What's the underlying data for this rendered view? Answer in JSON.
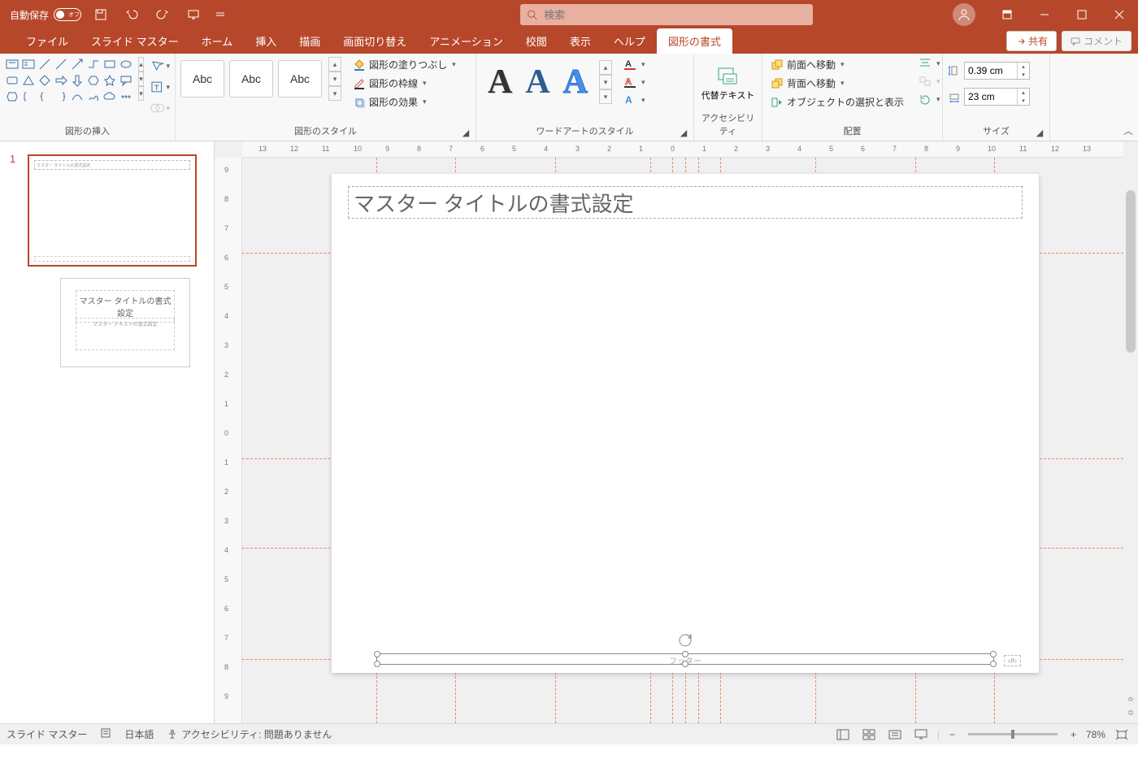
{
  "titlebar": {
    "autosave_label": "自動保存",
    "autosave_state": "オフ",
    "search_placeholder": "検索"
  },
  "tabs": {
    "file": "ファイル",
    "slide_master": "スライド マスター",
    "home": "ホーム",
    "insert": "挿入",
    "draw": "描画",
    "transitions": "画面切り替え",
    "animations": "アニメーション",
    "review": "校閲",
    "view": "表示",
    "help": "ヘルプ",
    "shape_format": "図形の書式",
    "share": "共有",
    "comment": "コメント"
  },
  "ribbon": {
    "groups": {
      "insert_shapes": "図形の挿入",
      "shape_styles": "図形のスタイル",
      "wordart_styles": "ワードアートのスタイル",
      "accessibility": "アクセシビリティ",
      "arrange": "配置",
      "size": "サイズ"
    },
    "style_swatch_text": "Abc",
    "shape_fill": "図形の塗りつぶし",
    "shape_outline": "図形の枠線",
    "shape_effects": "図形の効果",
    "alt_text": "代替テキスト",
    "bring_forward": "前面へ移動",
    "send_backward": "背面へ移動",
    "selection_pane": "オブジェクトの選択と表示",
    "height_value": "0.39 cm",
    "width_value": "23 cm"
  },
  "slide": {
    "master_index": "1",
    "title_placeholder": "マスター タイトルの書式設定",
    "sub_body_text": "マスター テキストの書式設定",
    "footer_text": "フッター",
    "pagenum_text": "‹#›"
  },
  "ruler": {
    "h": [
      "13",
      "12",
      "11",
      "10",
      "9",
      "8",
      "7",
      "6",
      "5",
      "4",
      "3",
      "2",
      "1",
      "0",
      "1",
      "2",
      "3",
      "4",
      "5",
      "6",
      "7",
      "8",
      "9",
      "10",
      "11",
      "12",
      "13"
    ],
    "v": [
      "9",
      "8",
      "7",
      "6",
      "5",
      "4",
      "3",
      "2",
      "1",
      "0",
      "1",
      "2",
      "3",
      "4",
      "5",
      "6",
      "7",
      "8",
      "9"
    ]
  },
  "status": {
    "mode": "スライド マスター",
    "language": "日本語",
    "accessibility": "アクセシビリティ: 問題ありません",
    "zoom": "78%"
  }
}
